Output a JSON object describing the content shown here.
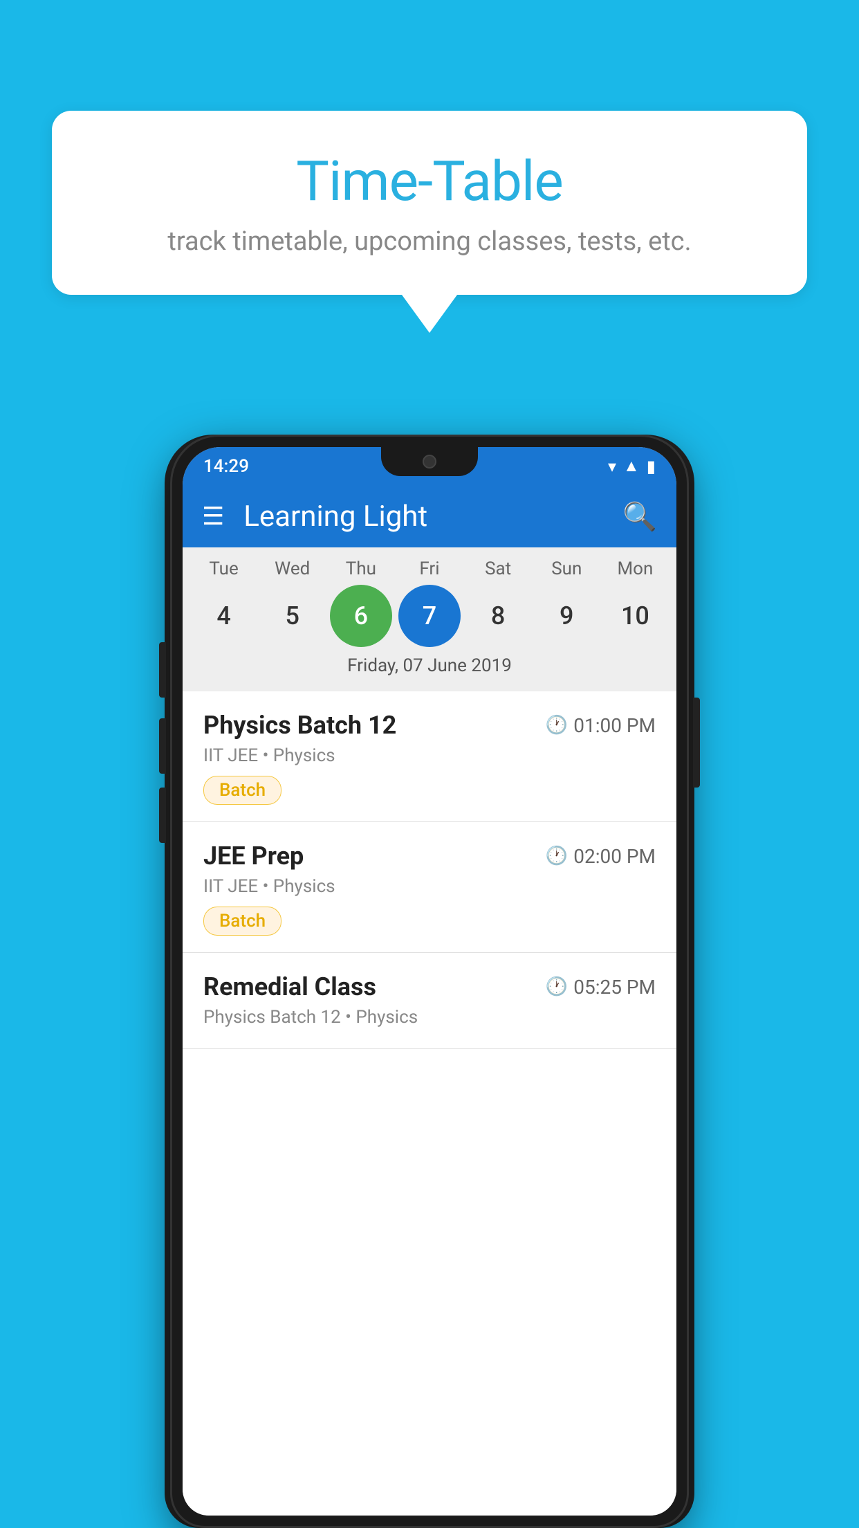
{
  "background_color": "#1ab8e8",
  "speech_bubble": {
    "title": "Time-Table",
    "subtitle": "track timetable, upcoming classes, tests, etc."
  },
  "phone": {
    "status_bar": {
      "time": "14:29"
    },
    "app_bar": {
      "title": "Learning Light"
    },
    "calendar": {
      "days": [
        "Tue",
        "Wed",
        "Thu",
        "Fri",
        "Sat",
        "Sun",
        "Mon"
      ],
      "dates": [
        "4",
        "5",
        "6",
        "7",
        "8",
        "9",
        "10"
      ],
      "today_index": 2,
      "selected_index": 3,
      "selected_date_label": "Friday, 07 June 2019"
    },
    "schedule": [
      {
        "title": "Physics Batch 12",
        "time": "01:00 PM",
        "subtitle": "IIT JEE • Physics",
        "tag": "Batch"
      },
      {
        "title": "JEE Prep",
        "time": "02:00 PM",
        "subtitle": "IIT JEE • Physics",
        "tag": "Batch"
      },
      {
        "title": "Remedial Class",
        "time": "05:25 PM",
        "subtitle": "Physics Batch 12 • Physics",
        "tag": null
      }
    ]
  }
}
